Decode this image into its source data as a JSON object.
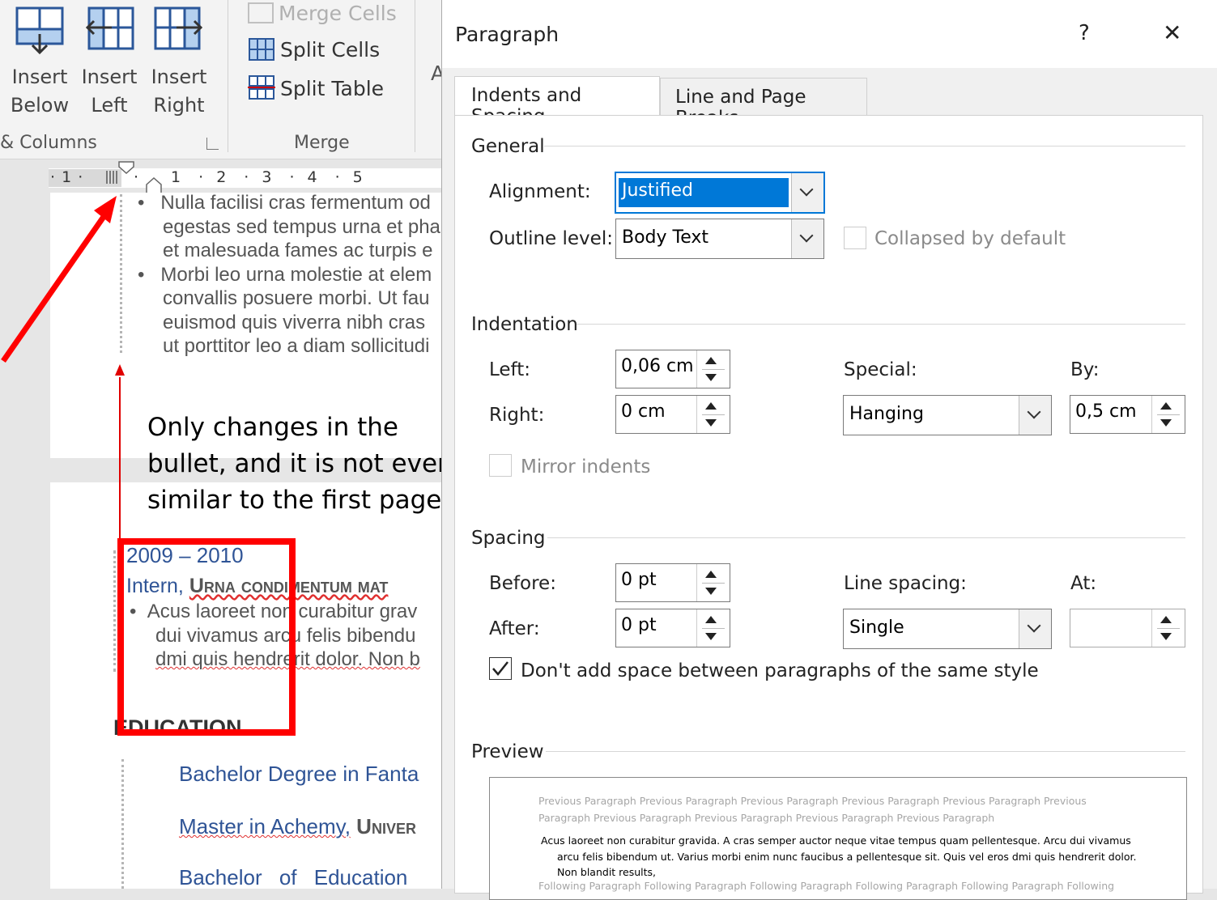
{
  "ribbon": {
    "insert_below": [
      "Insert",
      "Below"
    ],
    "insert_left": [
      "Insert",
      "Left"
    ],
    "insert_right": [
      "Insert",
      "Right"
    ],
    "group_rows_columns": "& Columns",
    "merge_cells": "Merge Cells",
    "split_cells": "Split Cells",
    "split_table": "Split Table",
    "group_merge": "Merge"
  },
  "ruler": {
    "numbers": [
      "1",
      "1",
      "2",
      "3",
      "4",
      "5"
    ]
  },
  "document": {
    "page1_lines": [
      "Nulla facilisi cras fermentum od",
      "egestas sed tempus urna et pha",
      "et malesuada fames ac turpis e",
      "Morbi leo urna molestie at elem",
      "convallis posuere morbi. Ut fau",
      "euismod quis viverra nibh cras",
      "ut porttitor leo a diam sollicitudi"
    ],
    "annotation": [
      "Only changes in the",
      "bullet, and it is not even",
      "similar to the first page"
    ],
    "date": "2009 – 2010",
    "intern_label": "Intern,",
    "intern_company": "Urna condimentum mat",
    "page2_lines": [
      "Acus laoreet non curabitur grav",
      "dui vivamus arcu felis bibendu",
      "dmi quis hendrerit dolor. Non b"
    ],
    "education_heading": "EDUCATION",
    "edu1": "Bachelor Degree in Fanta",
    "edu2_a": "Master in Achemy,",
    "edu2_b": "Univer",
    "edu3": "Bachelor of Education"
  },
  "dialog": {
    "title": "Paragraph",
    "help": "?",
    "close": "✕",
    "tabs": [
      "Indents and Spacing",
      "Line and Page Breaks"
    ],
    "general": {
      "header": "General",
      "alignment_label": "Alignment:",
      "alignment_value": "Justified",
      "outline_label": "Outline level:",
      "outline_value": "Body Text",
      "collapsed_label": "Collapsed by default"
    },
    "indentation": {
      "header": "Indentation",
      "left_label": "Left:",
      "left_value": "0,06 cm",
      "right_label": "Right:",
      "right_value": "0 cm",
      "special_label": "Special:",
      "special_value": "Hanging",
      "by_label": "By:",
      "by_value": "0,5 cm",
      "mirror_label": "Mirror indents"
    },
    "spacing": {
      "header": "Spacing",
      "before_label": "Before:",
      "before_value": "0 pt",
      "after_label": "After:",
      "after_value": "0 pt",
      "line_spacing_label": "Line spacing:",
      "line_spacing_value": "Single",
      "at_label": "At:",
      "at_value": "",
      "dont_add_label": "Don't add space between paragraphs of the same style",
      "dont_add_checked": true
    },
    "preview": {
      "header": "Preview",
      "previous": [
        "Previous Paragraph Previous Paragraph Previous Paragraph Previous Paragraph Previous Paragraph Previous",
        "Paragraph Previous Paragraph Previous Paragraph Previous Paragraph Previous Paragraph"
      ],
      "sample": [
        "Acus laoreet non curabitur gravida. A cras semper auctor neque vitae tempus quam pellentesque. Arcu dui vivamus",
        "arcu felis bibendum ut. Varius morbi enim nunc faucibus a pellentesque sit. Quis vel eros dmi quis hendrerit dolor.",
        "Non blandit results,"
      ],
      "following": "Following Paragraph Following Paragraph Following Paragraph Following Paragraph Following Paragraph Following"
    }
  },
  "colors": {
    "annotation_red": "#ff0000",
    "selection_blue": "#0078d7",
    "heading_blue": "#2f5496"
  }
}
